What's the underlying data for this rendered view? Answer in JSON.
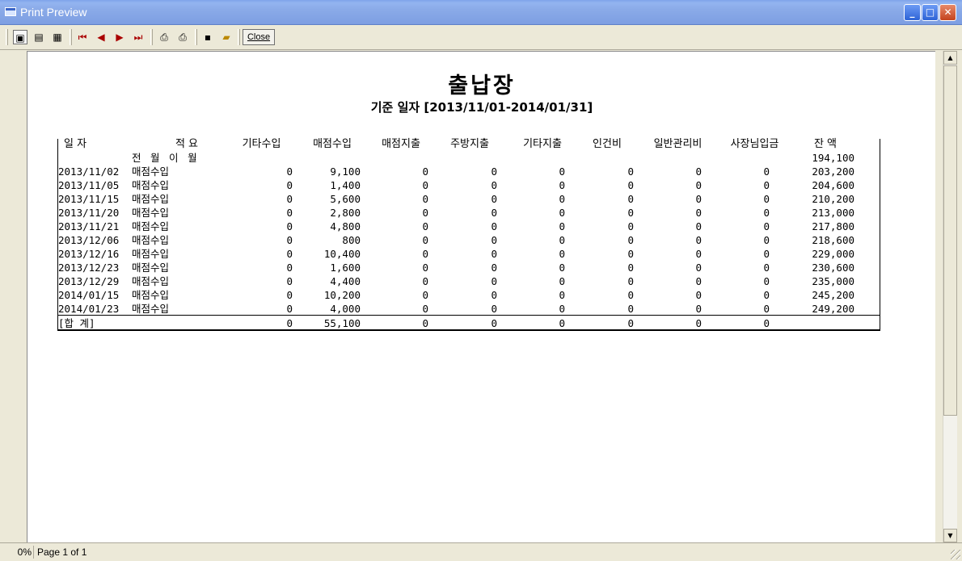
{
  "window": {
    "title": "Print Preview"
  },
  "toolbar": {
    "close_label": "Close"
  },
  "status": {
    "zoom": "0%",
    "page": "Page 1 of 1"
  },
  "report": {
    "title": "출납장",
    "subtitle": "기준 일자 [2013/11/01-2014/01/31]",
    "headers": [
      "일 자",
      "적   요",
      "기타수입",
      "매점수입",
      "매점지출",
      "주방지출",
      "기타지출",
      "인건비",
      "일반관리비",
      "사장님입금",
      "잔  액"
    ],
    "carry_over": {
      "label": "전 월 이 월",
      "balance": "194,100"
    },
    "rows": [
      [
        "2013/11/02",
        "매점수입",
        "0",
        "9,100",
        "0",
        "0",
        "0",
        "0",
        "0",
        "0",
        "203,200"
      ],
      [
        "2013/11/05",
        "매점수입",
        "0",
        "1,400",
        "0",
        "0",
        "0",
        "0",
        "0",
        "0",
        "204,600"
      ],
      [
        "2013/11/15",
        "매점수입",
        "0",
        "5,600",
        "0",
        "0",
        "0",
        "0",
        "0",
        "0",
        "210,200"
      ],
      [
        "2013/11/20",
        "매점수입",
        "0",
        "2,800",
        "0",
        "0",
        "0",
        "0",
        "0",
        "0",
        "213,000"
      ],
      [
        "2013/11/21",
        "매점수입",
        "0",
        "4,800",
        "0",
        "0",
        "0",
        "0",
        "0",
        "0",
        "217,800"
      ],
      [
        "2013/12/06",
        "매점수입",
        "0",
        "800",
        "0",
        "0",
        "0",
        "0",
        "0",
        "0",
        "218,600"
      ],
      [
        "2013/12/16",
        "매점수입",
        "0",
        "10,400",
        "0",
        "0",
        "0",
        "0",
        "0",
        "0",
        "229,000"
      ],
      [
        "2013/12/23",
        "매점수입",
        "0",
        "1,600",
        "0",
        "0",
        "0",
        "0",
        "0",
        "0",
        "230,600"
      ],
      [
        "2013/12/29",
        "매점수입",
        "0",
        "4,400",
        "0",
        "0",
        "0",
        "0",
        "0",
        "0",
        "235,000"
      ],
      [
        "2014/01/15",
        "매점수입",
        "0",
        "10,200",
        "0",
        "0",
        "0",
        "0",
        "0",
        "0",
        "245,200"
      ],
      [
        "2014/01/23",
        "매점수입",
        "0",
        "4,000",
        "0",
        "0",
        "0",
        "0",
        "0",
        "0",
        "249,200"
      ]
    ],
    "total": {
      "label": "[합  계]",
      "values": [
        "0",
        "55,100",
        "0",
        "0",
        "0",
        "0",
        "0",
        "0"
      ]
    }
  }
}
